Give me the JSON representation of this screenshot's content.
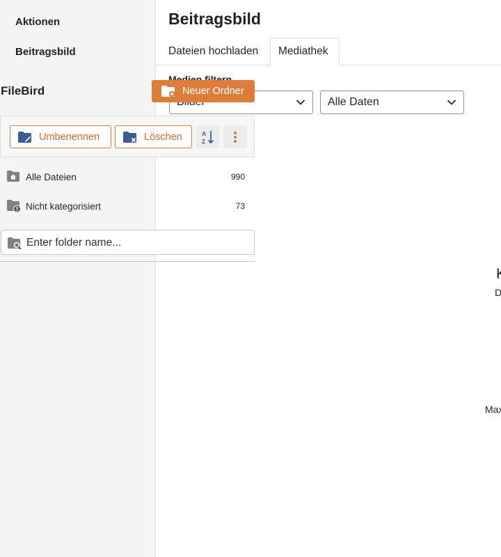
{
  "sidebar": {
    "actions_label": "Aktionen",
    "featured_label": "Beitragsbild"
  },
  "filebird": {
    "title": "FileBird",
    "new_folder_label": "Neuer Ordner",
    "rename_label": "Umbenennen",
    "delete_label": "Löschen",
    "folders": [
      {
        "label": "Alle Dateien",
        "count": "990"
      },
      {
        "label": "Nicht kategorisiert",
        "count": "73"
      }
    ],
    "search_placeholder": "Enter folder name...",
    "colors": {
      "accent": "#dd7d3c",
      "icon_blue": "#3c5d93"
    }
  },
  "modal": {
    "title": "Beitragsbild",
    "tabs": [
      {
        "label": "Dateien hochladen"
      },
      {
        "label": "Mediathek"
      }
    ],
    "filter_label": "Medien filtern",
    "type_filter_value": "Bilder",
    "date_filter_value": "Alle Daten",
    "cut_off_text": {
      "heading": "K",
      "line": "D",
      "max": "Max"
    }
  }
}
